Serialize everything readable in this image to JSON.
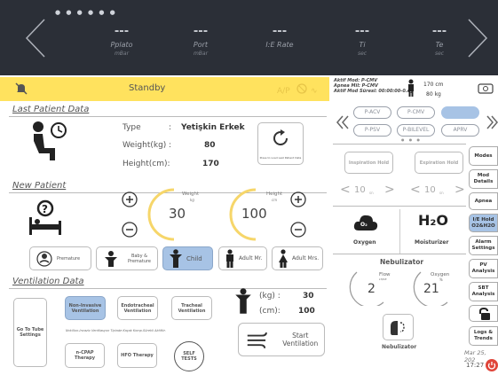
{
  "top": {
    "params": [
      {
        "value": "---",
        "name": "Pplato",
        "unit": "mBar"
      },
      {
        "value": "---",
        "name": "Port",
        "unit": "mBar"
      },
      {
        "value": "---",
        "name": "I:E Rate",
        "unit": ""
      },
      {
        "value": "---",
        "name": "Ti",
        "unit": "sec"
      },
      {
        "value": "---",
        "name": "Te",
        "unit": "sec"
      }
    ],
    "page_dots": "● ● ● ● ● ●"
  },
  "standby": {
    "label": "Standby"
  },
  "status": {
    "line1": "Aktif Mod: P-CMV",
    "line2": "Apnea Mil: P-CMV",
    "line3": "Aktif Mod Süresi: 00:00:00-0.dy",
    "height": "170",
    "height_unit": "cm",
    "weight": "80",
    "weight_unit": "kg"
  },
  "last_patient": {
    "title": "Last Patient Data",
    "type_label": "Type",
    "sep": ":",
    "type_value": "Yetişkin Erkek",
    "weight_label": "Weight(kg)",
    "weight_sep": ":",
    "weight_value": "80",
    "height_label": "Height(cm):",
    "height_value": "170",
    "load_hint": "Press to Load Last Patient Data"
  },
  "new_patient": {
    "title": "New Patient",
    "weight_label": "Weight",
    "weight_unit": "kg",
    "weight_value": "30",
    "height_label": "Height",
    "height_unit": "cm",
    "height_value": "100",
    "categories": [
      "Premature",
      "Baby & Premature",
      "Child",
      "Adult Mr.",
      "Adult Mrs."
    ],
    "selected": "Child"
  },
  "ventilation": {
    "title": "Ventilation Data",
    "buttons": [
      "Non-Invasive Ventilation",
      "Endotracheal Ventilation",
      "Tracheal Ventilation"
    ],
    "goto": "Go To Tube Settings",
    "note": "Not:Non-Invaziv Ventilasyon Tipinde Kaçak Komp.Sürekli Aktiftir.",
    "therapy": [
      "n-CPAP Therapy",
      "HFO Therapy",
      "SELF TESTS"
    ],
    "kg_label": "(kg) :",
    "kg_value": "30",
    "cm_label": "(cm):",
    "cm_value": "100",
    "start": "Start Ventilation"
  },
  "modes": {
    "row1": [
      "P-ACV",
      "P-CMV",
      ""
    ],
    "row2": [
      "P-PSV",
      "P-BILEVEL",
      "APRV"
    ]
  },
  "holds": {
    "insp": "Inspiration Hold",
    "exp": "Expiration Hold",
    "insp_val": "10",
    "exp_val": "10",
    "unit": "sn"
  },
  "gas": {
    "oxygen": "Oxygen",
    "moist": "Moisturizer",
    "o2": "O₂",
    "h2o": "H₂O"
  },
  "nebulizer": {
    "title": "Nebulizator",
    "flow_label": "Flow",
    "flow_unit": "LT/DK",
    "flow_value": "2",
    "oxy_label": "Oxygen",
    "oxy_unit": "%",
    "oxy_value": "21",
    "button": "Nebulizator"
  },
  "side": {
    "items": [
      "Modes",
      "Mod Details",
      "Apnea",
      "I/E Hold O2&H2O",
      "Alarm Settings",
      "PV Analysis",
      "SBT Analysis",
      "",
      "Logs & Trends"
    ],
    "date": "Mar 25, 202",
    "time": "17:27"
  },
  "colors": {
    "accent": "#a7c3e5",
    "standby": "#ffe25e",
    "gauge": "#f6d66a",
    "power": "#e0453a"
  }
}
